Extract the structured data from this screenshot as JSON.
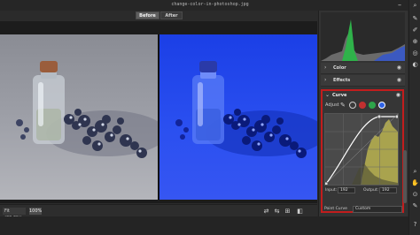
{
  "window": {
    "title": "change-color-in-photoshop.jpg"
  },
  "view_toggle": {
    "before_label": "Before",
    "after_label": "After"
  },
  "statusbar": {
    "fit_label": "Fit (32.3%)",
    "zoom_label": "100%"
  },
  "panel": {
    "sections": [
      {
        "label": "Color"
      },
      {
        "label": "Effects"
      }
    ],
    "curve": {
      "label": "Curve",
      "adjust_label": "Adjust",
      "input_label": "Input:",
      "input_value": "192",
      "output_label": "Output:",
      "output_value": "192",
      "point_curve_label": "Point Curve",
      "point_curve_value": "Custom"
    }
  },
  "colors": {
    "accent_highlight": "#c21d1d",
    "after_tint": "#2a4ff0",
    "histogram_green": "#2fb24a"
  },
  "icons": [
    "close-icon",
    "search-icon",
    "brush-icon",
    "crop-icon",
    "eye-icon",
    "chevron-right-icon",
    "chevron-down-icon"
  ]
}
